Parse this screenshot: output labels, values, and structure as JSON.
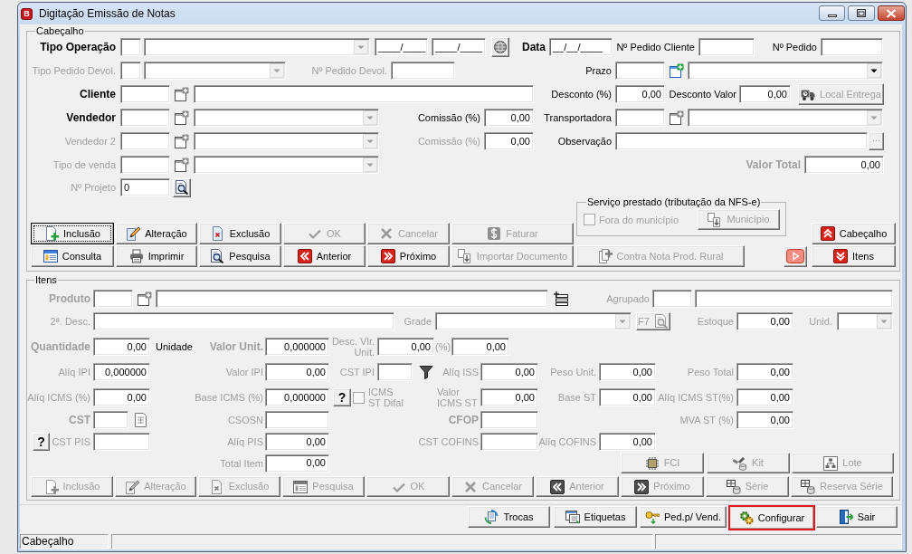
{
  "window": {
    "badge": "B",
    "title": "Digitação Emissão de Notas"
  },
  "header": {
    "title": "Cabeçalho",
    "rows": [
      {
        "items": [
          {
            "kind": "label",
            "text": "Tipo Operação",
            "required": true,
            "disabled": false
          },
          {
            "kind": "field"
          },
          {
            "kind": "combo",
            "disabled": true
          },
          {
            "kind": "field",
            "value": "____/____"
          },
          {
            "kind": "field",
            "value": "____/____"
          },
          {
            "kind": "icon_button",
            "disabled": false
          },
          {
            "kind": "label",
            "text": "Data",
            "required": true,
            "disabled": false
          },
          {
            "kind": "field",
            "value": "__/__/____"
          },
          {
            "kind": "label",
            "text": "Nº Pedido Cliente",
            "required": false,
            "disabled": false
          },
          {
            "kind": "field"
          },
          {
            "kind": "label",
            "text": "Nº Pedido",
            "required": false,
            "disabled": false
          },
          {
            "kind": "field"
          }
        ]
      },
      {
        "items": [
          {
            "kind": "label",
            "text": "Tipo Pedido Devol.",
            "required": false,
            "disabled": true
          },
          {
            "kind": "field"
          },
          {
            "kind": "combo",
            "disabled": true
          },
          {
            "kind": "label",
            "text": "Nº Pedido Devol.",
            "required": false,
            "disabled": true
          },
          {
            "kind": "field"
          },
          {
            "kind": "label",
            "text": "Prazo",
            "required": false,
            "disabled": false
          },
          {
            "kind": "field"
          },
          {
            "kind": "icon_button",
            "disabled": false
          },
          {
            "kind": "combo",
            "disabled": false
          }
        ]
      },
      {
        "items": [
          {
            "kind": "label",
            "text": "Cliente",
            "required": true,
            "disabled": false
          },
          {
            "kind": "field"
          },
          {
            "kind": "icon_button",
            "disabled": true
          },
          {
            "kind": "field"
          },
          {
            "kind": "label",
            "text": "Desconto (%)",
            "required": false,
            "disabled": false
          },
          {
            "kind": "field",
            "value": "0,00"
          },
          {
            "kind": "label",
            "text": "Desconto Valor",
            "required": false,
            "disabled": false
          },
          {
            "kind": "field",
            "value": "0,00"
          },
          {
            "kind": "button",
            "label": "Local Entrega",
            "disabled": true
          }
        ]
      },
      {
        "items": [
          {
            "kind": "label",
            "text": "Vendedor",
            "required": true,
            "disabled": false
          },
          {
            "kind": "field"
          },
          {
            "kind": "icon_button",
            "disabled": true
          },
          {
            "kind": "combo",
            "disabled": true
          },
          {
            "kind": "label",
            "text": "Comissão (%)",
            "required": false,
            "disabled": false
          },
          {
            "kind": "field",
            "value": "0,00"
          },
          {
            "kind": "label",
            "text": "Transportadora",
            "required": false,
            "disabled": false
          },
          {
            "kind": "field"
          },
          {
            "kind": "icon_button",
            "disabled": true
          },
          {
            "kind": "combo",
            "disabled": true
          }
        ]
      },
      {
        "items": [
          {
            "kind": "label",
            "text": "Vendedor 2",
            "required": false,
            "disabled": true
          },
          {
            "kind": "field"
          },
          {
            "kind": "icon_button",
            "disabled": true
          },
          {
            "kind": "combo",
            "disabled": true
          },
          {
            "kind": "label",
            "text": "Comissão (%)",
            "required": false,
            "disabled": true
          },
          {
            "kind": "field",
            "value": "0,00"
          },
          {
            "kind": "label",
            "text": "Observação",
            "required": false,
            "disabled": false
          },
          {
            "kind": "field"
          },
          {
            "kind": "button",
            "label": "...",
            "disabled": true
          }
        ]
      },
      {
        "items": [
          {
            "kind": "label",
            "text": "Tipo de venda",
            "required": false,
            "disabled": true
          },
          {
            "kind": "field"
          },
          {
            "kind": "icon_button",
            "disabled": true
          },
          {
            "kind": "combo",
            "disabled": true
          },
          {
            "kind": "label",
            "text": "Valor Total",
            "required": true,
            "disabled": true
          },
          {
            "kind": "field",
            "value": "0,00"
          }
        ]
      },
      {
        "items": [
          {
            "kind": "label",
            "text": "Nº Projeto",
            "required": false,
            "disabled": true
          },
          {
            "kind": "field",
            "value": "0"
          },
          {
            "kind": "icon_button",
            "disabled": false
          }
        ]
      }
    ],
    "action_rows": [
      {
        "buttons": [
          {
            "label": "Inclusão",
            "disabled": false,
            "focused": true
          },
          {
            "label": "Alteração",
            "disabled": false,
            "focused": false
          },
          {
            "label": "Exclusão",
            "disabled": false,
            "focused": false
          },
          {
            "label": "OK",
            "disabled": true,
            "focused": false
          },
          {
            "label": "Cancelar",
            "disabled": true,
            "focused": false
          },
          {
            "label": "Faturar",
            "disabled": true,
            "focused": false
          }
        ]
      },
      {
        "buttons": [
          {
            "label": "Consulta",
            "disabled": false,
            "focused": false
          },
          {
            "label": "Imprimir",
            "disabled": false,
            "focused": false
          },
          {
            "label": "Pesquisa",
            "disabled": false,
            "focused": false
          },
          {
            "label": "Anterior",
            "disabled": false,
            "focused": false
          },
          {
            "label": "Próximo",
            "disabled": false,
            "focused": false
          },
          {
            "label": "Importar Documento",
            "disabled": true,
            "focused": false
          }
        ]
      }
    ],
    "service": {
      "title": "Serviço prestado (tributação da NFS-e)",
      "checkbox": {
        "label": "Fora do município",
        "checked": false,
        "disabled": true
      },
      "button": {
        "label": "Município",
        "disabled": true
      }
    },
    "contra_nota_button": {
      "label": "Contra Nota Prod. Rural",
      "disabled": true
    },
    "section_buttons": [
      {
        "label": "Cabeçalho",
        "disabled": false
      },
      {
        "label": "Itens",
        "disabled": false
      }
    ]
  },
  "items_group": {
    "title": "Itens",
    "rows": [
      {
        "items": [
          {
            "kind": "label",
            "text": "Produto",
            "required": true,
            "disabled": true
          },
          {
            "kind": "field"
          },
          {
            "kind": "icon_button",
            "disabled": true
          },
          {
            "kind": "field"
          },
          {
            "kind": "icon_button",
            "disabled": false
          },
          {
            "kind": "label",
            "text": "Agrupado",
            "required": false,
            "disabled": true
          },
          {
            "kind": "field"
          },
          {
            "kind": "field"
          }
        ]
      },
      {
        "items": [
          {
            "kind": "label",
            "text": "2ª. Desc.",
            "required": false,
            "disabled": true
          },
          {
            "kind": "field"
          },
          {
            "kind": "label",
            "text": "Grade",
            "required": false,
            "disabled": true
          },
          {
            "kind": "combo",
            "disabled": true
          },
          {
            "kind": "button",
            "label": "F7",
            "disabled": true
          },
          {
            "kind": "label",
            "text": "Estoque",
            "required": false,
            "disabled": true
          },
          {
            "kind": "field",
            "value": "0,00"
          },
          {
            "kind": "label",
            "text": "Unid.",
            "required": false,
            "disabled": true
          },
          {
            "kind": "combo",
            "disabled": true
          }
        ]
      },
      {
        "items": [
          {
            "kind": "label",
            "text": "Quantidade",
            "required": true,
            "disabled": true
          },
          {
            "kind": "field",
            "value": "0,00"
          },
          {
            "kind": "label",
            "text": "Unidade",
            "required": false,
            "disabled": false
          },
          {
            "kind": "label",
            "text": "Valor Unit.",
            "required": true,
            "disabled": true
          },
          {
            "kind": "field",
            "value": "0,000000"
          },
          {
            "kind": "label",
            "text": "Desc. Vlr.\nUnit.",
            "required": false,
            "disabled": true
          },
          {
            "kind": "field",
            "value": "0,00"
          },
          {
            "kind": "label",
            "text": "(%)",
            "required": false,
            "disabled": true
          },
          {
            "kind": "field",
            "value": "0,00"
          }
        ]
      },
      {
        "items": [
          {
            "kind": "label",
            "text": "Alíq IPI",
            "required": false,
            "disabled": true
          },
          {
            "kind": "field",
            "value": "0,000000"
          },
          {
            "kind": "label",
            "text": "Valor IPI",
            "required": false,
            "disabled": true
          },
          {
            "kind": "field",
            "value": "0,00"
          },
          {
            "kind": "label",
            "text": "CST IPI",
            "required": false,
            "disabled": true
          },
          {
            "kind": "field"
          },
          {
            "kind": "icon_button",
            "disabled": false
          },
          {
            "kind": "label",
            "text": "Alíq ISS",
            "required": false,
            "disabled": true
          },
          {
            "kind": "field",
            "value": "0,00"
          },
          {
            "kind": "label",
            "text": "Peso Unit.",
            "required": false,
            "disabled": true
          },
          {
            "kind": "field",
            "value": "0,00"
          },
          {
            "kind": "label",
            "text": "Peso Total",
            "required": false,
            "disabled": true
          },
          {
            "kind": "field",
            "value": "0,00"
          }
        ]
      },
      {
        "items": [
          {
            "kind": "label",
            "text": "Alíq ICMS (%)",
            "required": false,
            "disabled": true
          },
          {
            "kind": "field",
            "value": "0,00"
          },
          {
            "kind": "label",
            "text": "Base ICMS (%)",
            "required": false,
            "disabled": true
          },
          {
            "kind": "field",
            "value": "0,000000"
          },
          {
            "kind": "button",
            "label": "?",
            "disabled": false
          },
          {
            "kind": "checkbox",
            "label": "ICMS\nST Difal",
            "checked": false,
            "disabled": true
          },
          {
            "kind": "label",
            "text": "Valor\nICMS ST",
            "required": false,
            "disabled": true
          },
          {
            "kind": "field",
            "value": "0,00"
          },
          {
            "kind": "label",
            "text": "Base ST",
            "required": false,
            "disabled": true
          },
          {
            "kind": "field",
            "value": "0,00"
          },
          {
            "kind": "label",
            "text": "Alíq ICMS ST(%)",
            "required": false,
            "disabled": true
          },
          {
            "kind": "field",
            "value": "0,00"
          }
        ]
      },
      {
        "items": [
          {
            "kind": "label",
            "text": "CST",
            "required": true,
            "disabled": true
          },
          {
            "kind": "field"
          },
          {
            "kind": "icon_button",
            "disabled": true
          },
          {
            "kind": "label",
            "text": "CSOSN",
            "required": false,
            "disabled": true
          },
          {
            "kind": "field"
          },
          {
            "kind": "label",
            "text": "CFOP",
            "required": true,
            "disabled": true
          },
          {
            "kind": "field"
          },
          {
            "kind": "label",
            "text": "MVA ST (%)",
            "required": false,
            "disabled": true
          },
          {
            "kind": "field",
            "value": "0,00"
          }
        ]
      },
      {
        "items": [
          {
            "kind": "button",
            "label": "?",
            "disabled": false
          },
          {
            "kind": "label",
            "text": "CST PIS",
            "required": false,
            "disabled": true
          },
          {
            "kind": "field"
          },
          {
            "kind": "label",
            "text": "Alíq PIS",
            "required": false,
            "disabled": true
          },
          {
            "kind": "field",
            "value": "0,00"
          },
          {
            "kind": "label",
            "text": "CST COFINS",
            "required": false,
            "disabled": true
          },
          {
            "kind": "field"
          },
          {
            "kind": "label",
            "text": "Alíq COFINS",
            "required": false,
            "disabled": true
          },
          {
            "kind": "field",
            "value": "0,00"
          }
        ]
      },
      {
        "items": [
          {
            "kind": "label",
            "text": "Total Item",
            "required": false,
            "disabled": true
          },
          {
            "kind": "field",
            "value": "0,00"
          },
          {
            "kind": "button",
            "label": "FCI",
            "disabled": true
          },
          {
            "kind": "button",
            "label": "Kit",
            "disabled": true
          },
          {
            "kind": "button",
            "label": "Lote",
            "disabled": true
          }
        ]
      },
      {
        "items": [
          {
            "kind": "button",
            "label": "Inclusão",
            "disabled": true
          },
          {
            "kind": "button",
            "label": "Alteração",
            "disabled": true
          },
          {
            "kind": "button",
            "label": "Exclusão",
            "disabled": true
          },
          {
            "kind": "button",
            "label": "Pesquisa",
            "disabled": true
          },
          {
            "kind": "button",
            "label": "OK",
            "disabled": true
          },
          {
            "kind": "button",
            "label": "Cancelar",
            "disabled": true
          },
          {
            "kind": "button",
            "label": "Anterior",
            "disabled": true
          },
          {
            "kind": "button",
            "label": "Próximo",
            "disabled": true
          },
          {
            "kind": "button",
            "label": "Série",
            "disabled": true
          },
          {
            "kind": "button",
            "label": "Reserva Série",
            "disabled": true
          }
        ]
      }
    ]
  },
  "toolbar": [
    {
      "label": "Trocas",
      "highlighted": false
    },
    {
      "label": "Etiquetas",
      "highlighted": false
    },
    {
      "label": "Ped.p/ Vend.",
      "highlighted": false
    },
    {
      "label": "Configurar",
      "highlighted": true
    },
    {
      "label": "Sair",
      "highlighted": false
    }
  ],
  "status_bar": {
    "text": "Cabeçalho"
  }
}
